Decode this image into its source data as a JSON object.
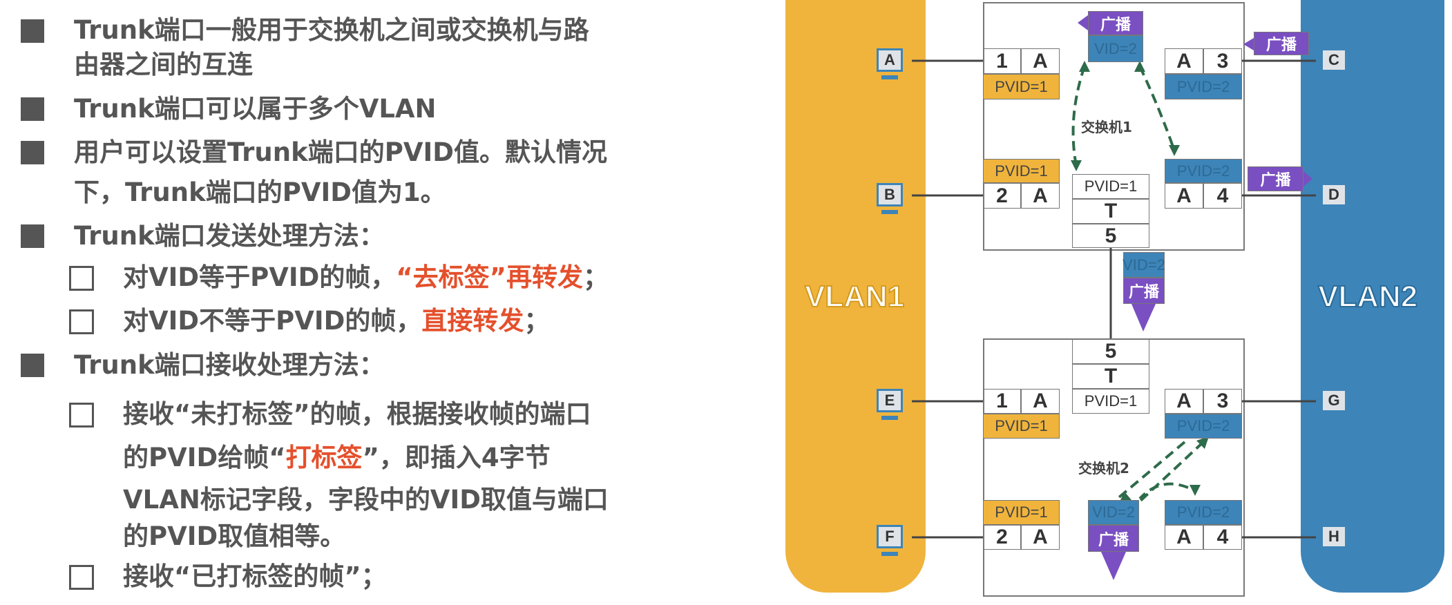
{
  "text": {
    "b1_l1": "Trunk端口一般用于交换机之间或交换机与路",
    "b1_l2": "由器之间的互连",
    "b2": "Trunk端口可以属于多个VLAN",
    "b3_l1": "用户可以设置Trunk端口的PVID值。默认情况",
    "b3_l2": "下，Trunk端口的PVID值为1。",
    "b4": "Trunk端口发送处理方法：",
    "b4_s1_a": "对VID等于PVID的帧，",
    "b4_s1_red": "“去标签”再转发",
    "b4_s1_b": "；",
    "b4_s2_a": "对VID不等于PVID的帧，",
    "b4_s2_red": "直接转发",
    "b4_s2_b": "；",
    "b5": "Trunk端口接收处理方法：",
    "b5_s1_l1": "接收“未打标签”的帧，根据接收帧的端口",
    "b5_s1_l2a": "的PVID给帧“",
    "b5_s1_l2red": "打标签",
    "b5_s1_l2b": "”，即插入4字节",
    "b5_s1_l3": "VLAN标记字段，字段中的VID取值与端口",
    "b5_s1_l4": "的PVID取值相等。",
    "b5_s2": "接收“已打标签的帧”；"
  },
  "diagram": {
    "vlan1": "VLAN1",
    "vlan2": "VLAN2",
    "switch1": "交换机1",
    "switch2": "交换机2",
    "hosts": [
      "A",
      "B",
      "C",
      "D",
      "E",
      "F",
      "G",
      "H"
    ],
    "port1": "1",
    "port2": "2",
    "port3": "3",
    "port4": "4",
    "port5": "5",
    "access": "A",
    "trunk": "T",
    "pvid1": "PVID=1",
    "pvid2": "PVID=2",
    "vid2": "VID=2",
    "broadcast": "广播"
  },
  "colors": {
    "vlan1": "#f0b43c",
    "vlan2": "#3d84b8",
    "frame": "#7a4fc2",
    "arrow": "#2e6b4a",
    "highlight": "#e4502c"
  }
}
